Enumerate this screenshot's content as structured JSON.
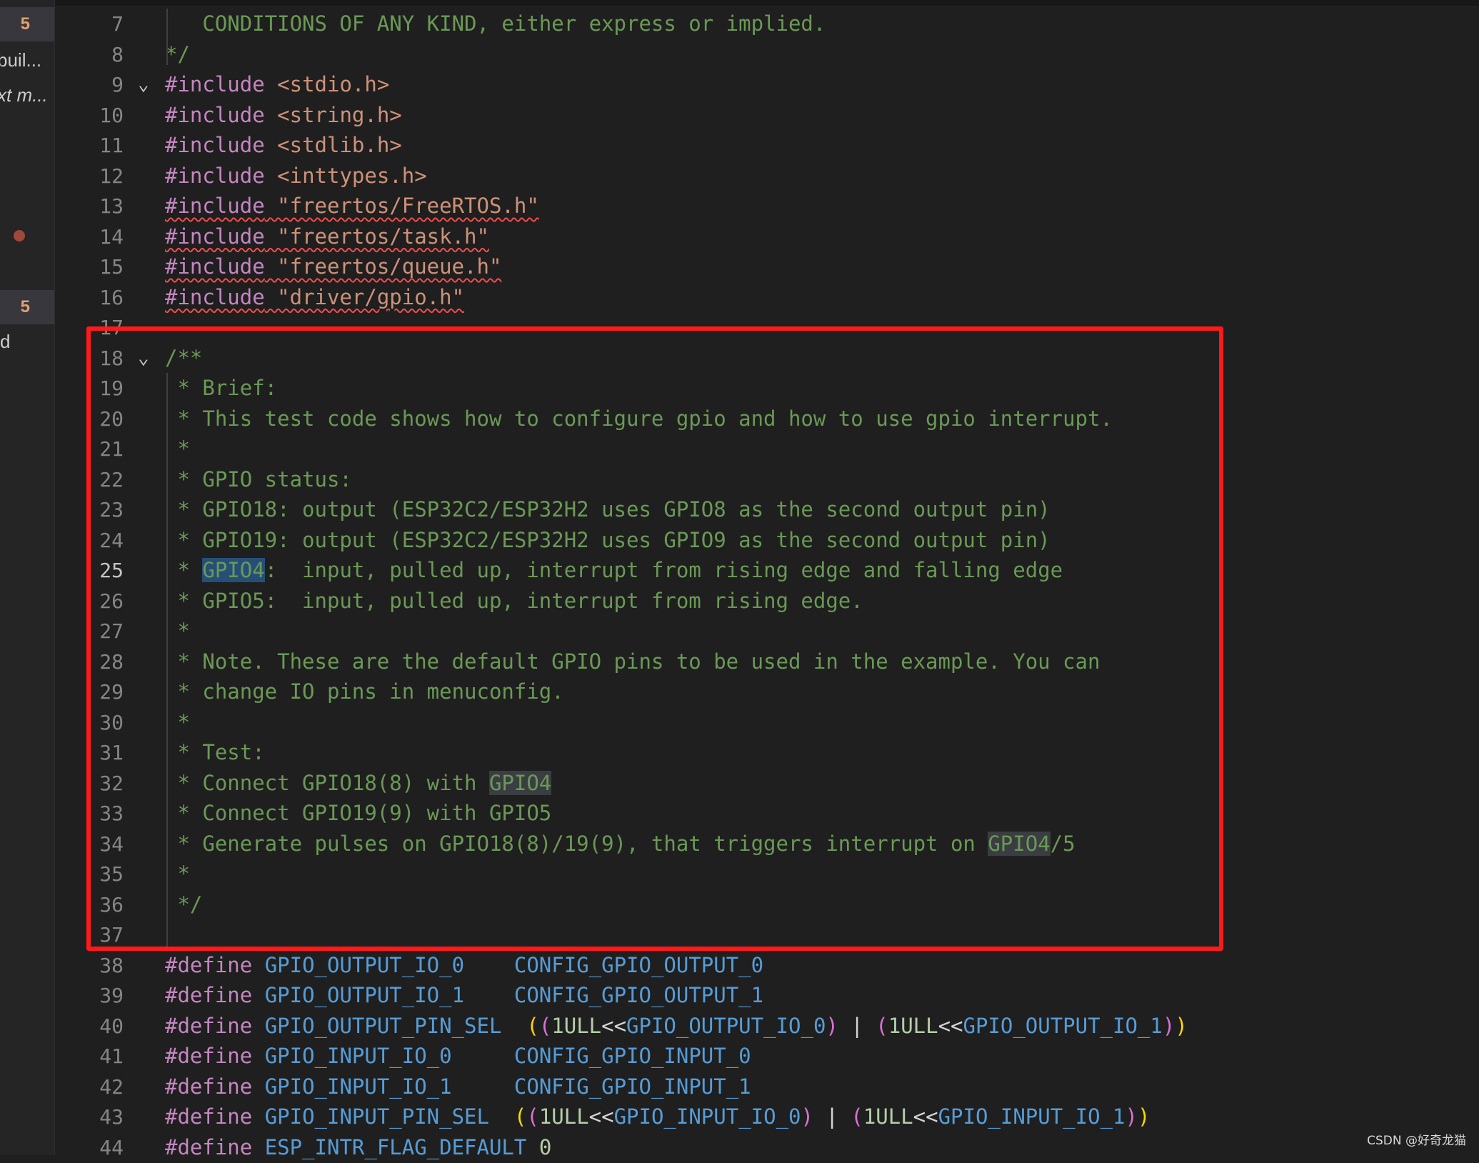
{
  "sidebar": {
    "rows": [
      {
        "badge": "5"
      },
      {
        "text": "buil..."
      },
      {
        "text": "xt m..."
      },
      {
        "badge": "5"
      },
      {
        "text": "d"
      }
    ]
  },
  "editor": {
    "active_line": "25",
    "lines": [
      {
        "num": "7",
        "tokens": [
          {
            "t": "   CONDITIONS OF ANY KIND, either express or implied.",
            "c": "cmt"
          }
        ]
      },
      {
        "num": "8",
        "tokens": [
          {
            "t": "*/",
            "c": "cmt"
          }
        ]
      },
      {
        "num": "9",
        "fold": "⌄",
        "tokens": [
          {
            "t": "#include",
            "c": "kw"
          },
          {
            "t": " <stdio.h>",
            "c": "str"
          }
        ]
      },
      {
        "num": "10",
        "tokens": [
          {
            "t": "#include",
            "c": "kw"
          },
          {
            "t": " <string.h>",
            "c": "str"
          }
        ]
      },
      {
        "num": "11",
        "tokens": [
          {
            "t": "#include",
            "c": "kw"
          },
          {
            "t": " <stdlib.h>",
            "c": "str"
          }
        ]
      },
      {
        "num": "12",
        "tokens": [
          {
            "t": "#include",
            "c": "kw"
          },
          {
            "t": " <inttypes.h>",
            "c": "str"
          }
        ]
      },
      {
        "num": "13",
        "squiggle": true,
        "tokens": [
          {
            "t": "#include",
            "c": "kw"
          },
          {
            "t": " \"freertos/FreeRTOS.h\"",
            "c": "str"
          }
        ]
      },
      {
        "num": "14",
        "squiggle": true,
        "tokens": [
          {
            "t": "#include",
            "c": "kw"
          },
          {
            "t": " \"freertos/task.h\"",
            "c": "str"
          }
        ]
      },
      {
        "num": "15",
        "squiggle": true,
        "tokens": [
          {
            "t": "#include",
            "c": "kw"
          },
          {
            "t": " \"freertos/queue.h\"",
            "c": "str"
          }
        ]
      },
      {
        "num": "16",
        "squiggle": true,
        "tokens": [
          {
            "t": "#include",
            "c": "kw"
          },
          {
            "t": " \"driver/gpio.h\"",
            "c": "str"
          }
        ]
      },
      {
        "num": "17",
        "tokens": []
      },
      {
        "num": "18",
        "fold": "⌄",
        "tokens": [
          {
            "t": "/**",
            "c": "cmt"
          }
        ]
      },
      {
        "num": "19",
        "tokens": [
          {
            "t": " * Brief:",
            "c": "cmt"
          }
        ]
      },
      {
        "num": "20",
        "tokens": [
          {
            "t": " * This test code shows how to configure gpio and how to use gpio interrupt.",
            "c": "cmt"
          }
        ]
      },
      {
        "num": "21",
        "tokens": [
          {
            "t": " *",
            "c": "cmt"
          }
        ]
      },
      {
        "num": "22",
        "tokens": [
          {
            "t": " * GPIO status:",
            "c": "cmt"
          }
        ]
      },
      {
        "num": "23",
        "tokens": [
          {
            "t": " * GPIO18: output (ESP32C2/ESP32H2 uses GPIO8 as the second output pin)",
            "c": "cmt"
          }
        ]
      },
      {
        "num": "24",
        "tokens": [
          {
            "t": " * GPIO19: output (ESP32C2/ESP32H2 uses GPIO9 as the second output pin)",
            "c": "cmt"
          }
        ]
      },
      {
        "num": "25",
        "tokens": [
          {
            "t": " * ",
            "c": "cmt"
          },
          {
            "t": "GPIO4",
            "c": "sel"
          },
          {
            "t": ":  input, pulled up, interrupt from rising edge and falling edge",
            "c": "cmt"
          }
        ]
      },
      {
        "num": "26",
        "tokens": [
          {
            "t": " * GPIO5:  input, pulled up, interrupt from rising edge.",
            "c": "cmt"
          }
        ]
      },
      {
        "num": "27",
        "tokens": [
          {
            "t": " *",
            "c": "cmt"
          }
        ]
      },
      {
        "num": "28",
        "tokens": [
          {
            "t": " * Note. These are the default GPIO pins to be used in the example. You can",
            "c": "cmt"
          }
        ]
      },
      {
        "num": "29",
        "tokens": [
          {
            "t": " * change IO pins in menuconfig.",
            "c": "cmt"
          }
        ]
      },
      {
        "num": "30",
        "tokens": [
          {
            "t": " *",
            "c": "cmt"
          }
        ]
      },
      {
        "num": "31",
        "tokens": [
          {
            "t": " * Test:",
            "c": "cmt"
          }
        ]
      },
      {
        "num": "32",
        "tokens": [
          {
            "t": " * Connect GPIO18(8) with ",
            "c": "cmt"
          },
          {
            "t": "GPIO4",
            "c": "occ"
          }
        ]
      },
      {
        "num": "33",
        "tokens": [
          {
            "t": " * Connect GPIO19(9) with GPIO5",
            "c": "cmt"
          }
        ]
      },
      {
        "num": "34",
        "tokens": [
          {
            "t": " * Generate pulses on GPIO18(8)/19(9), that triggers interrupt on ",
            "c": "cmt"
          },
          {
            "t": "GPIO4",
            "c": "occ"
          },
          {
            "t": "/5",
            "c": "cmt"
          }
        ]
      },
      {
        "num": "35",
        "tokens": [
          {
            "t": " *",
            "c": "cmt"
          }
        ]
      },
      {
        "num": "36",
        "tokens": [
          {
            "t": " */",
            "c": "cmt"
          }
        ]
      },
      {
        "num": "37",
        "tokens": []
      },
      {
        "num": "38",
        "tokens": [
          {
            "t": "#define",
            "c": "kw"
          },
          {
            "t": " ",
            "c": "op"
          },
          {
            "t": "GPIO_OUTPUT_IO_0",
            "c": "mac"
          },
          {
            "t": "    ",
            "c": "op"
          },
          {
            "t": "CONFIG_GPIO_OUTPUT_0",
            "c": "mac"
          }
        ]
      },
      {
        "num": "39",
        "tokens": [
          {
            "t": "#define",
            "c": "kw"
          },
          {
            "t": " ",
            "c": "op"
          },
          {
            "t": "GPIO_OUTPUT_IO_1",
            "c": "mac"
          },
          {
            "t": "    ",
            "c": "op"
          },
          {
            "t": "CONFIG_GPIO_OUTPUT_1",
            "c": "mac"
          }
        ]
      },
      {
        "num": "40",
        "tokens": [
          {
            "t": "#define",
            "c": "kw"
          },
          {
            "t": " ",
            "c": "op"
          },
          {
            "t": "GPIO_OUTPUT_PIN_SEL",
            "c": "mac"
          },
          {
            "t": "  ",
            "c": "op"
          },
          {
            "t": "(",
            "c": "p1"
          },
          {
            "t": "(",
            "c": "p2"
          },
          {
            "t": "1ULL",
            "c": "num"
          },
          {
            "t": "<<",
            "c": "op"
          },
          {
            "t": "GPIO_OUTPUT_IO_0",
            "c": "mac"
          },
          {
            "t": ")",
            "c": "p2"
          },
          {
            "t": " | ",
            "c": "op"
          },
          {
            "t": "(",
            "c": "p2"
          },
          {
            "t": "1ULL",
            "c": "num"
          },
          {
            "t": "<<",
            "c": "op"
          },
          {
            "t": "GPIO_OUTPUT_IO_1",
            "c": "mac"
          },
          {
            "t": ")",
            "c": "p2"
          },
          {
            "t": ")",
            "c": "p1"
          }
        ]
      },
      {
        "num": "41",
        "tokens": [
          {
            "t": "#define",
            "c": "kw"
          },
          {
            "t": " ",
            "c": "op"
          },
          {
            "t": "GPIO_INPUT_IO_0",
            "c": "mac"
          },
          {
            "t": "     ",
            "c": "op"
          },
          {
            "t": "CONFIG_GPIO_INPUT_0",
            "c": "mac"
          }
        ]
      },
      {
        "num": "42",
        "tokens": [
          {
            "t": "#define",
            "c": "kw"
          },
          {
            "t": " ",
            "c": "op"
          },
          {
            "t": "GPIO_INPUT_IO_1",
            "c": "mac"
          },
          {
            "t": "     ",
            "c": "op"
          },
          {
            "t": "CONFIG_GPIO_INPUT_1",
            "c": "mac"
          }
        ]
      },
      {
        "num": "43",
        "tokens": [
          {
            "t": "#define",
            "c": "kw"
          },
          {
            "t": " ",
            "c": "op"
          },
          {
            "t": "GPIO_INPUT_PIN_SEL",
            "c": "mac"
          },
          {
            "t": "  ",
            "c": "op"
          },
          {
            "t": "(",
            "c": "p1"
          },
          {
            "t": "(",
            "c": "p2"
          },
          {
            "t": "1ULL",
            "c": "num"
          },
          {
            "t": "<<",
            "c": "op"
          },
          {
            "t": "GPIO_INPUT_IO_0",
            "c": "mac"
          },
          {
            "t": ")",
            "c": "p2"
          },
          {
            "t": " | ",
            "c": "op"
          },
          {
            "t": "(",
            "c": "p2"
          },
          {
            "t": "1ULL",
            "c": "num"
          },
          {
            "t": "<<",
            "c": "op"
          },
          {
            "t": "GPIO_INPUT_IO_1",
            "c": "mac"
          },
          {
            "t": ")",
            "c": "p2"
          },
          {
            "t": ")",
            "c": "p1"
          }
        ]
      },
      {
        "num": "44",
        "tokens": [
          {
            "t": "#define",
            "c": "kw"
          },
          {
            "t": " ",
            "c": "op"
          },
          {
            "t": "ESP_INTR_FLAG_DEFAULT",
            "c": "mac"
          },
          {
            "t": " ",
            "c": "op"
          },
          {
            "t": "0",
            "c": "num"
          }
        ]
      }
    ]
  },
  "colors": {
    "background": "#1f1f1f",
    "keyword": "#c586c0",
    "string": "#ce9178",
    "comment": "#6a9955",
    "macro": "#569cd6",
    "number": "#b5cea8",
    "annotation_box": "#ff1a1a"
  },
  "watermark": "CSDN @好奇龙猫"
}
